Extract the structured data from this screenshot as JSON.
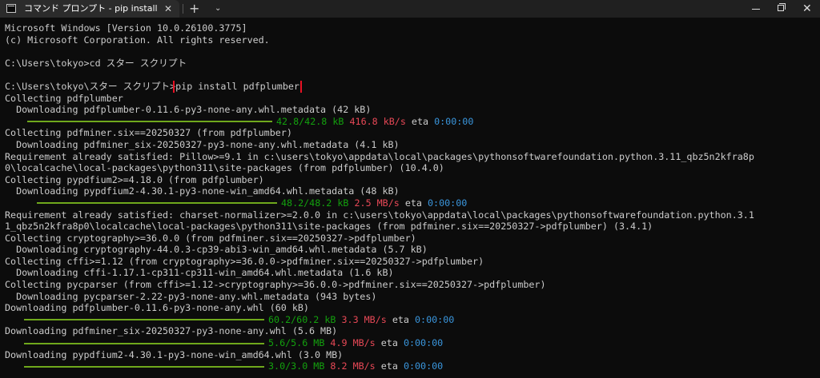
{
  "window": {
    "tab_title": "コマンド プロンプト - pip  install pdfplumber",
    "tab_close": "✕",
    "new_tab": "+",
    "dropdown": "⌄",
    "close": "✕"
  },
  "colors": {
    "background": "#0c0c0c",
    "text": "#cccccc",
    "green": "#13a10e",
    "red": "#e74856",
    "cyan": "#3a96dd",
    "bar": "#6fa81c",
    "highlight": "#e81123"
  },
  "terminal": {
    "header1": "Microsoft Windows [Version 10.0.26100.3775]",
    "header2": "(c) Microsoft Corporation. All rights reserved.",
    "cd_cmd": "C:\\Users\\tokyo>cd スター スクリプト",
    "prompt": "C:\\Users\\tokyo\\スター スクリプト>",
    "command": "pip install pdfplumber",
    "l_collect1": "Collecting pdfplumber",
    "l_dl1": "  Downloading pdfplumber-0.11.6-py3-none-any.whl.metadata (42 kB)",
    "p1": {
      "size": "42.8/42.8 kB",
      "speed": "416.8 kB/s",
      "eta_label": "eta",
      "eta": "0:00:00"
    },
    "l_collect2": "Collecting pdfminer.six==20250327 (from pdfplumber)",
    "l_dl2": "  Downloading pdfminer_six-20250327-py3-none-any.whl.metadata (4.1 kB)",
    "l_req1a": "Requirement already satisfied: Pillow>=9.1 in c:\\users\\tokyo\\appdata\\local\\packages\\pythonsoftwarefoundation.python.3.11_qbz5n2kfra8p",
    "l_req1b": "0\\localcache\\local-packages\\python311\\site-packages (from pdfplumber) (10.4.0)",
    "l_collect3": "Collecting pypdfium2>=4.18.0 (from pdfplumber)",
    "l_dl3": "  Downloading pypdfium2-4.30.1-py3-none-win_amd64.whl.metadata (48 kB)",
    "p2": {
      "size": "48.2/48.2 kB",
      "speed": "2.5 MB/s",
      "eta_label": "eta",
      "eta": "0:00:00"
    },
    "l_req2a": "Requirement already satisfied: charset-normalizer>=2.0.0 in c:\\users\\tokyo\\appdata\\local\\packages\\pythonsoftwarefoundation.python.3.1",
    "l_req2b": "1_qbz5n2kfra8p0\\localcache\\local-packages\\python311\\site-packages (from pdfminer.six==20250327->pdfplumber) (3.4.1)",
    "l_collect4": "Collecting cryptography>=36.0.0 (from pdfminer.six==20250327->pdfplumber)",
    "l_dl4": "  Downloading cryptography-44.0.3-cp39-abi3-win_amd64.whl.metadata (5.7 kB)",
    "l_collect5": "Collecting cffi>=1.12 (from cryptography>=36.0.0->pdfminer.six==20250327->pdfplumber)",
    "l_dl5": "  Downloading cffi-1.17.1-cp311-cp311-win_amd64.whl.metadata (1.6 kB)",
    "l_collect6": "Collecting pycparser (from cffi>=1.12->cryptography>=36.0.0->pdfminer.six==20250327->pdfplumber)",
    "l_dl6": "  Downloading pycparser-2.22-py3-none-any.whl.metadata (943 bytes)",
    "l_dl7": "Downloading pdfplumber-0.11.6-py3-none-any.whl (60 kB)",
    "p3": {
      "size": "60.2/60.2 kB",
      "speed": "3.3 MB/s",
      "eta_label": "eta",
      "eta": "0:00:00"
    },
    "l_dl8": "Downloading pdfminer_six-20250327-py3-none-any.whl (5.6 MB)",
    "p4": {
      "size": "5.6/5.6 MB",
      "speed": "4.9 MB/s",
      "eta_label": "eta",
      "eta": "0:00:00"
    },
    "l_dl9": "Downloading pypdfium2-4.30.1-py3-none-win_amd64.whl (3.0 MB)",
    "p5": {
      "size": "3.0/3.0 MB",
      "speed": "8.2 MB/s",
      "eta_label": "eta",
      "eta": "0:00:00"
    }
  }
}
